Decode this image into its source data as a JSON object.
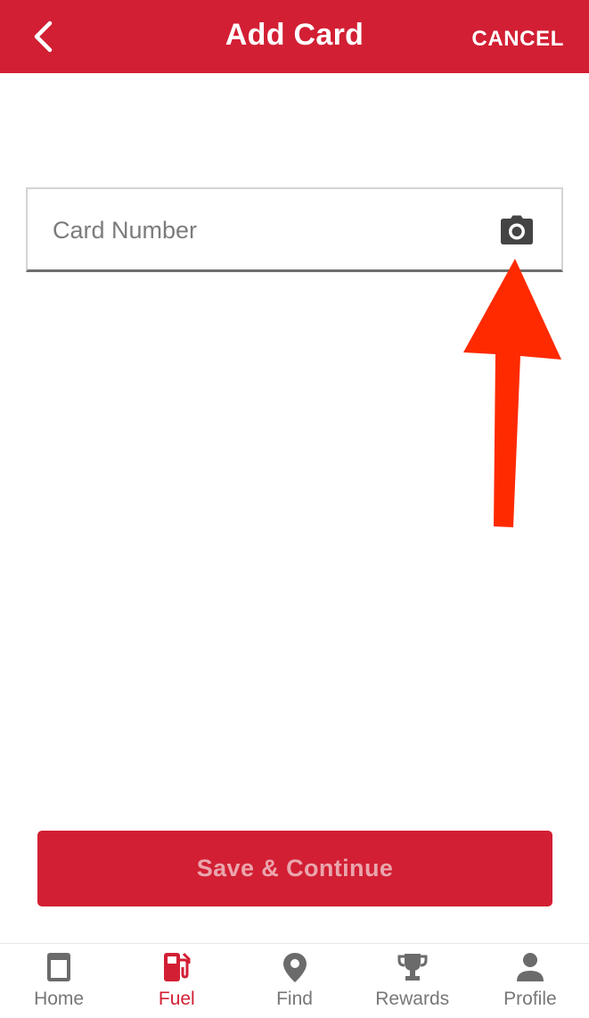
{
  "header": {
    "title": "Add Card",
    "cancel_label": "CANCEL"
  },
  "card_field": {
    "placeholder": "Card Number",
    "value": ""
  },
  "save_button": {
    "label": "Save & Continue"
  },
  "bottom_nav": {
    "items": [
      {
        "label": "Home",
        "icon": "home-icon",
        "active": false
      },
      {
        "label": "Fuel",
        "icon": "fuel-pump-icon",
        "active": true
      },
      {
        "label": "Find",
        "icon": "location-pin-icon",
        "active": false
      },
      {
        "label": "Rewards",
        "icon": "trophy-icon",
        "active": false
      },
      {
        "label": "Profile",
        "icon": "person-icon",
        "active": false
      }
    ]
  },
  "colors": {
    "brand_red": "#d21f34",
    "annotation_arrow": "#ff2a00",
    "inactive_gray": "#777777",
    "disabled_text": "#eaa5ad"
  }
}
